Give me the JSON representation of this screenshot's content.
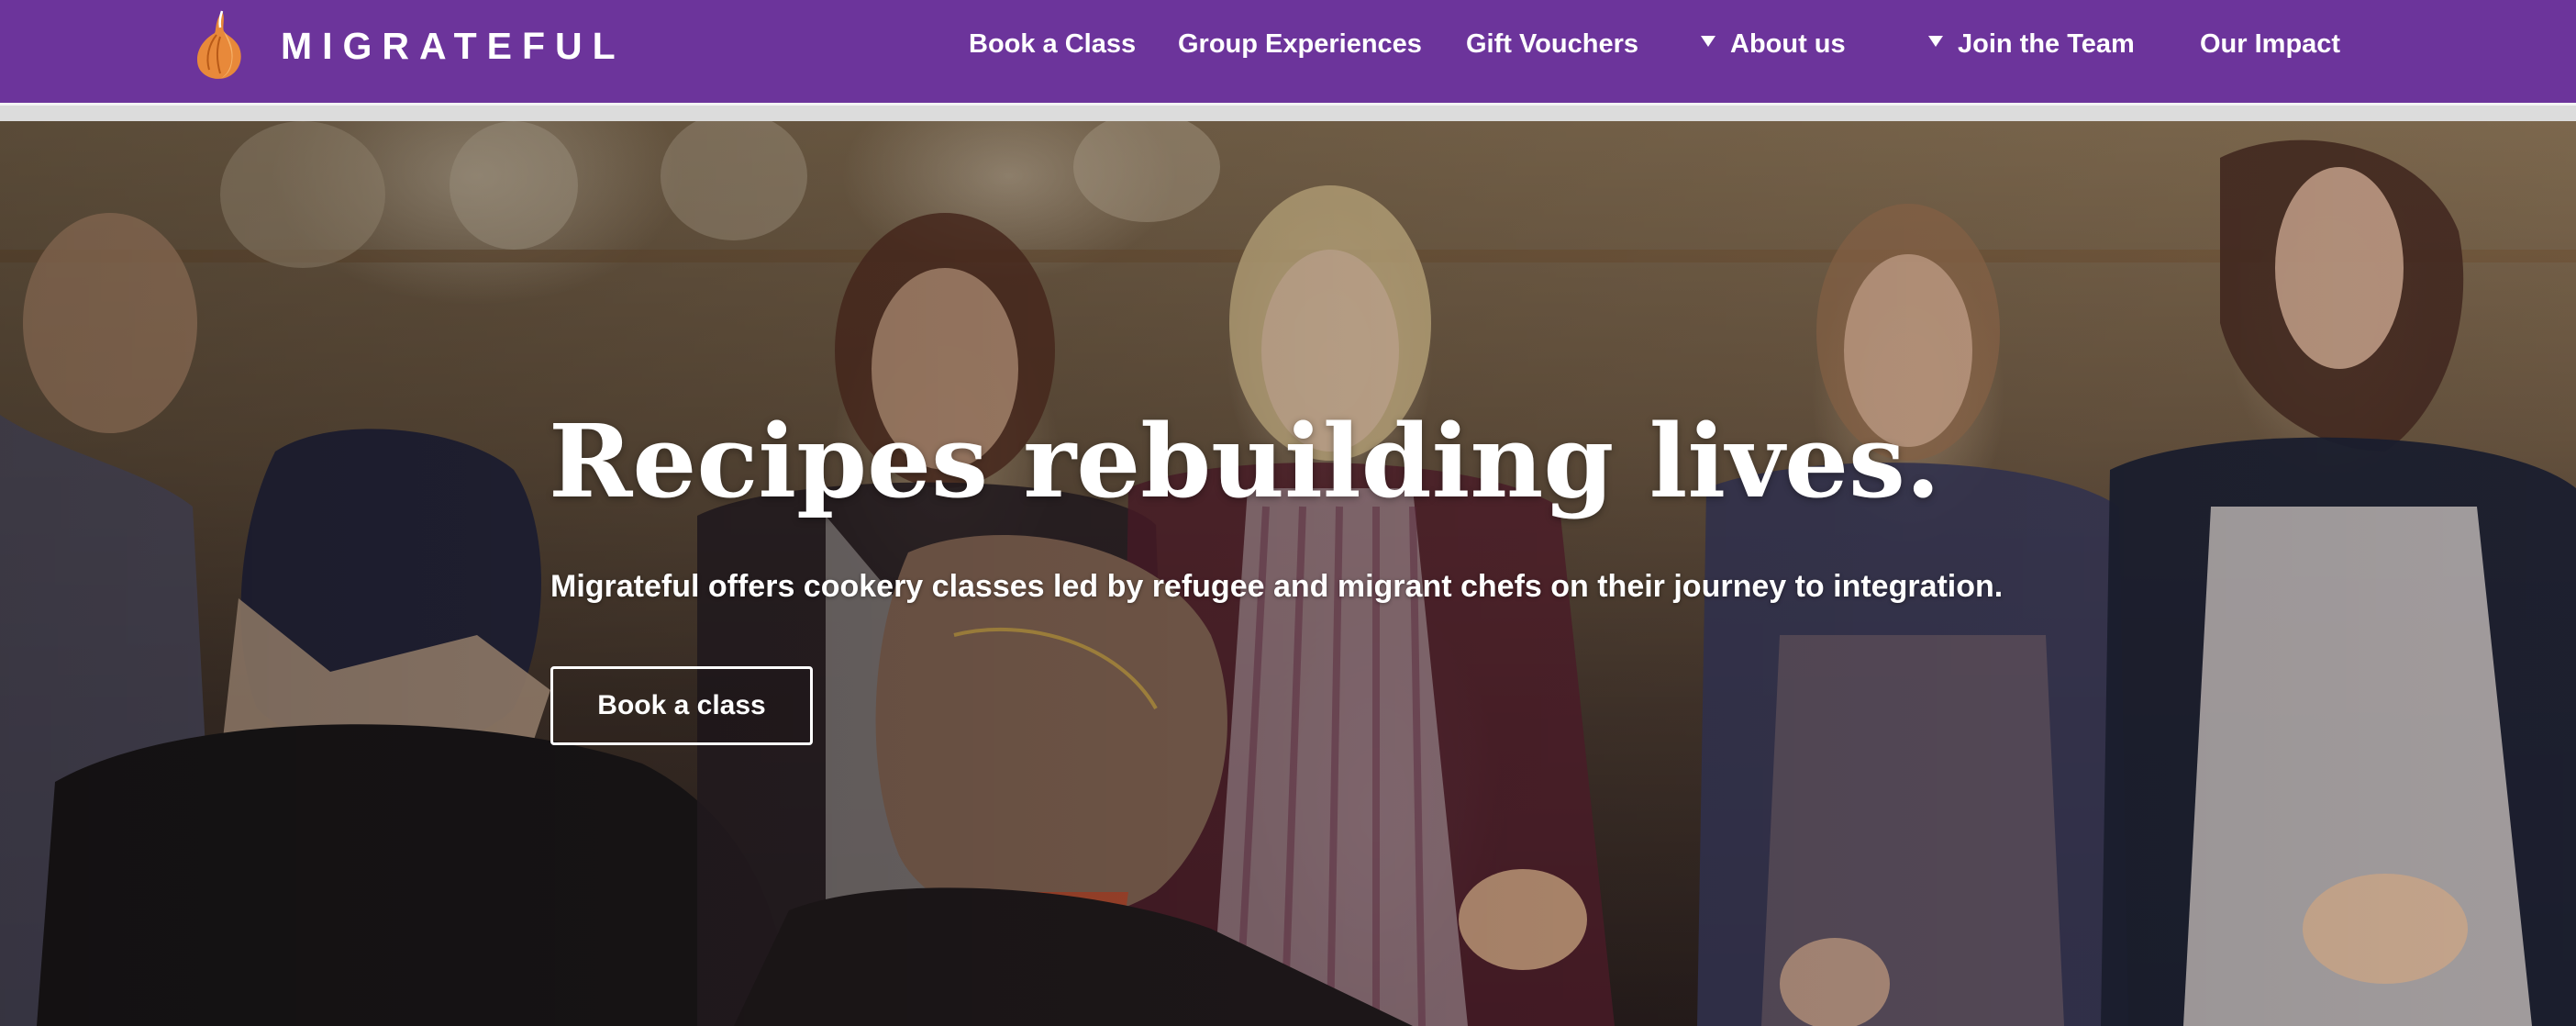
{
  "brand": {
    "name": "MIGRATEFUL",
    "logo_icon": "onion-logo-icon",
    "color": "#6c349b"
  },
  "nav": {
    "items": [
      {
        "label": "Book a Class",
        "dropdown": false
      },
      {
        "label": "Group Experiences",
        "dropdown": false
      },
      {
        "label": "Gift Vouchers",
        "dropdown": false
      },
      {
        "label": "About us",
        "dropdown": true
      },
      {
        "label": "Join the Team",
        "dropdown": true
      },
      {
        "label": "Our Impact",
        "dropdown": false
      }
    ]
  },
  "hero": {
    "headline": "Recipes rebuilding lives.",
    "subtitle": "Migrateful offers cookery classes led by refugee and migrant chefs on their journey to integration.",
    "cta_label": "Book a class"
  }
}
